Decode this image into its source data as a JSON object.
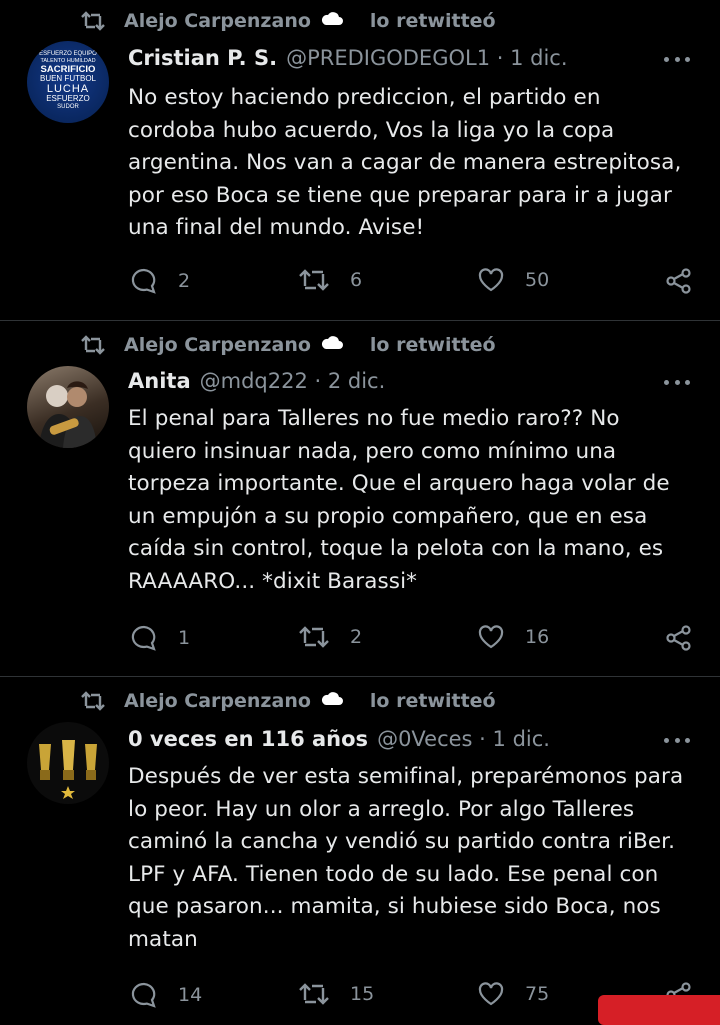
{
  "tweets": [
    {
      "retweeted_by": "Alejo Carpenzano",
      "retweet_suffix": "lo retwitteó",
      "name": "Cristian P. S.",
      "handle": "@PREDIGODEGOL1",
      "date": "1 dic.",
      "text_lines": [
        "No estoy haciendo prediccion, el partido en",
        "cordoba hubo acuerdo, Vos la liga yo la copa",
        "argentina. Nos van a cagar de manera estrepitosa,",
        "por eso Boca se tiene que preparar para ir a jugar",
        "una final del mundo. Avise!"
      ],
      "replies": "2",
      "retweets": "6",
      "likes": "50",
      "avatar_words": [
        "ESFUERZO EQUIPO",
        "TALENTO  HUMILDAD",
        "SACRIFICIO",
        "BUEN FUTBOL",
        "LUCHA",
        "ESFUERZO",
        "SUDOR"
      ]
    },
    {
      "retweeted_by": "Alejo Carpenzano",
      "retweet_suffix": "lo retwitteó",
      "name": "Anita",
      "handle": "@mdq222",
      "date": "2 dic.",
      "text_lines": [
        "El penal para Talleres no fue medio raro?? No",
        "quiero insinuar nada, pero como mínimo una",
        "torpeza importante. Que el arquero haga volar de",
        "un empujón a su propio compañero, que en esa",
        "caída sin control, toque la pelota con la mano, es",
        "RAAAARO... *dixit Barassi*"
      ],
      "replies": "1",
      "retweets": "2",
      "likes": "16"
    },
    {
      "retweeted_by": "Alejo Carpenzano",
      "retweet_suffix": "lo retwitteó",
      "name": "0 veces en 116 años",
      "handle": "@0Veces",
      "date": "1 dic.",
      "text_lines": [
        "Después de ver esta semifinal, preparémonos para",
        "lo peor. Hay un olor a arreglo. Por algo Talleres",
        "caminó la cancha y vendió su partido contra riBer.",
        "LPF y AFA. Tienen todo de su lado. Ese penal con",
        "que pasaron... mamita, si hubiese sido Boca, nos",
        "matan"
      ],
      "replies": "14",
      "retweets": "15",
      "likes": "75"
    }
  ]
}
